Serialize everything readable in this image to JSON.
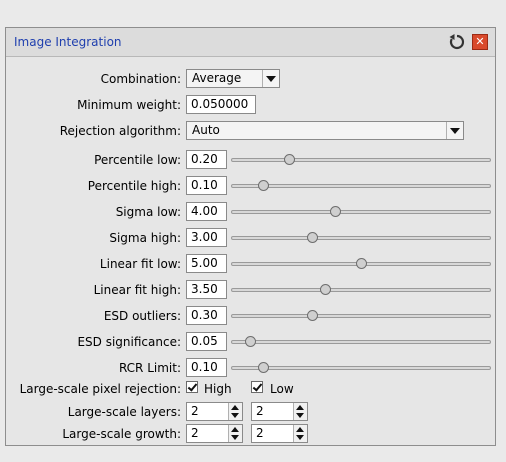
{
  "window": {
    "title": "Image Integration",
    "reset_icon": "reset-icon",
    "close_icon": "close-icon"
  },
  "combination": {
    "label": "Combination:",
    "value": "Average"
  },
  "minimum_weight": {
    "label": "Minimum weight:",
    "value": "0.050000"
  },
  "rejection_algorithm": {
    "label": "Rejection algorithm:",
    "value": "Auto"
  },
  "sliders": [
    {
      "label": "Percentile low:",
      "value": "0.20",
      "level": 0.22
    },
    {
      "label": "Percentile high:",
      "value": "0.10",
      "level": 0.12
    },
    {
      "label": "Sigma low:",
      "value": "4.00",
      "level": 0.4
    },
    {
      "label": "Sigma high:",
      "value": "3.00",
      "level": 0.31
    },
    {
      "label": "Linear fit low:",
      "value": "5.00",
      "level": 0.5
    },
    {
      "label": "Linear fit high:",
      "value": "3.50",
      "level": 0.36
    },
    {
      "label": "ESD outliers:",
      "value": "0.30",
      "level": 0.31
    },
    {
      "label": "ESD significance:",
      "value": "0.05",
      "level": 0.07
    },
    {
      "label": "RCR Limit:",
      "value": "0.10",
      "level": 0.12
    }
  ],
  "large_scale_rejection": {
    "label": "Large-scale pixel rejection:",
    "high_label": "High",
    "low_label": "Low",
    "high_checked": true,
    "low_checked": true
  },
  "large_scale_layers": {
    "label": "Large-scale layers:",
    "high": "2",
    "low": "2"
  },
  "large_scale_growth": {
    "label": "Large-scale growth:",
    "high": "2",
    "low": "2"
  }
}
